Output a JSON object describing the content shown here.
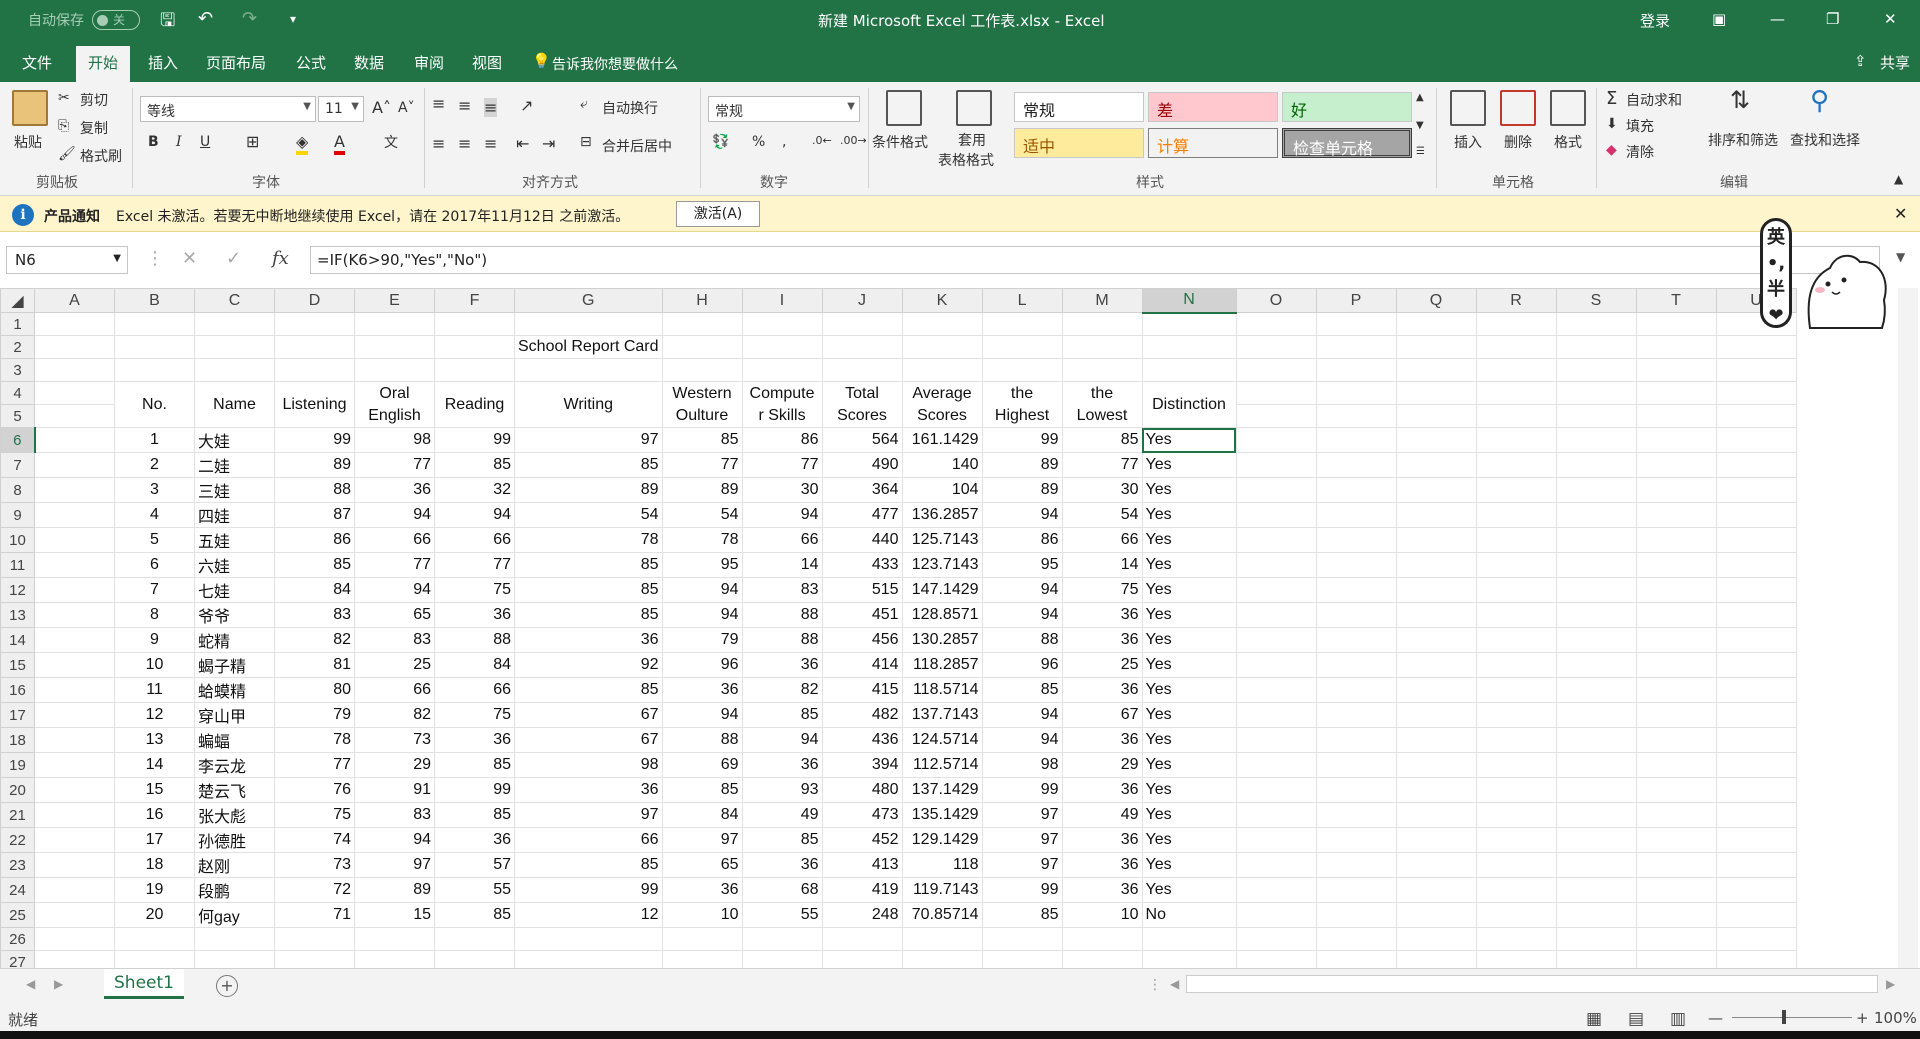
{
  "titlebar": {
    "autosave": "自动保存",
    "autosave_state": "关",
    "title": "新建 Microsoft Excel 工作表.xlsx  -  Excel",
    "login": "登录"
  },
  "menu": [
    "文件",
    "开始",
    "插入",
    "页面布局",
    "公式",
    "数据",
    "审阅",
    "视图"
  ],
  "tellme": "告诉我你想要做什么",
  "share": "共享",
  "ribbon": {
    "paste": "粘贴",
    "cut": "剪切",
    "copy": "复制",
    "format_painter": "格式刷",
    "font_name": "等线",
    "font_size": "11",
    "wrap": "自动换行",
    "merge": "合并后居中",
    "number_format": "常规",
    "cond_format": "条件格式",
    "table_format_1": "套用",
    "table_format_2": "表格格式",
    "styles": {
      "normal": "常规",
      "bad": "差",
      "good": "好",
      "neutral": "适中",
      "calc": "计算",
      "check": "检查单元格"
    },
    "insert": "插入",
    "delete": "删除",
    "format": "格式",
    "autosum": "自动求和",
    "fill": "填充",
    "clear": "清除",
    "sort_filter": "排序和筛选",
    "find_select": "查找和选择",
    "groups": {
      "clipboard": "剪贴板",
      "font": "字体",
      "alignment": "对齐方式",
      "number": "数字",
      "styles": "样式",
      "cells": "单元格",
      "editing": "编辑"
    }
  },
  "notification": {
    "label": "产品通知",
    "text": "Excel 未激活。若要无中断地继续使用 Excel，请在 2017年11月12日 之前激活。",
    "button": "激活(A)"
  },
  "formula_bar": {
    "name_box": "N6",
    "formula": "=IF(K6>90,\"Yes\",\"No\")"
  },
  "columns": [
    "A",
    "B",
    "C",
    "D",
    "E",
    "F",
    "G",
    "H",
    "I",
    "J",
    "K",
    "L",
    "M",
    "N",
    "O",
    "P",
    "Q",
    "R",
    "S",
    "T",
    "U"
  ],
  "sheet": {
    "title": "School Report Card",
    "headers": [
      "No.",
      "Name",
      "Listening",
      "Oral English",
      "Reading",
      "Writing",
      "Western Oulture",
      "Compute r Skills",
      "Total Scores",
      "Average Scores",
      "the Highest",
      "the Lowest",
      "Distinction"
    ],
    "rows": [
      [
        "1",
        "大娃",
        "99",
        "98",
        "99",
        "97",
        "85",
        "86",
        "564",
        "161.1429",
        "99",
        "85",
        "Yes"
      ],
      [
        "2",
        "二娃",
        "89",
        "77",
        "85",
        "85",
        "77",
        "77",
        "490",
        "140",
        "89",
        "77",
        "Yes"
      ],
      [
        "3",
        "三娃",
        "88",
        "36",
        "32",
        "89",
        "89",
        "30",
        "364",
        "104",
        "89",
        "30",
        "Yes"
      ],
      [
        "4",
        "四娃",
        "87",
        "94",
        "94",
        "54",
        "54",
        "94",
        "477",
        "136.2857",
        "94",
        "54",
        "Yes"
      ],
      [
        "5",
        "五娃",
        "86",
        "66",
        "66",
        "78",
        "78",
        "66",
        "440",
        "125.7143",
        "86",
        "66",
        "Yes"
      ],
      [
        "6",
        "六娃",
        "85",
        "77",
        "77",
        "85",
        "95",
        "14",
        "433",
        "123.7143",
        "95",
        "14",
        "Yes"
      ],
      [
        "7",
        "七娃",
        "84",
        "94",
        "75",
        "85",
        "94",
        "83",
        "515",
        "147.1429",
        "94",
        "75",
        "Yes"
      ],
      [
        "8",
        "爷爷",
        "83",
        "65",
        "36",
        "85",
        "94",
        "88",
        "451",
        "128.8571",
        "94",
        "36",
        "Yes"
      ],
      [
        "9",
        "蛇精",
        "82",
        "83",
        "88",
        "36",
        "79",
        "88",
        "456",
        "130.2857",
        "88",
        "36",
        "Yes"
      ],
      [
        "10",
        "蝎子精",
        "81",
        "25",
        "84",
        "92",
        "96",
        "36",
        "414",
        "118.2857",
        "96",
        "25",
        "Yes"
      ],
      [
        "11",
        "蛤蟆精",
        "80",
        "66",
        "66",
        "85",
        "36",
        "82",
        "415",
        "118.5714",
        "85",
        "36",
        "Yes"
      ],
      [
        "12",
        "穿山甲",
        "79",
        "82",
        "75",
        "67",
        "94",
        "85",
        "482",
        "137.7143",
        "94",
        "67",
        "Yes"
      ],
      [
        "13",
        "蝙蝠",
        "78",
        "73",
        "36",
        "67",
        "88",
        "94",
        "436",
        "124.5714",
        "94",
        "36",
        "Yes"
      ],
      [
        "14",
        "李云龙",
        "77",
        "29",
        "85",
        "98",
        "69",
        "36",
        "394",
        "112.5714",
        "98",
        "29",
        "Yes"
      ],
      [
        "15",
        "楚云飞",
        "76",
        "91",
        "99",
        "36",
        "85",
        "93",
        "480",
        "137.1429",
        "99",
        "36",
        "Yes"
      ],
      [
        "16",
        "张大彪",
        "75",
        "83",
        "85",
        "97",
        "84",
        "49",
        "473",
        "135.1429",
        "97",
        "49",
        "Yes"
      ],
      [
        "17",
        "孙德胜",
        "74",
        "94",
        "36",
        "66",
        "97",
        "85",
        "452",
        "129.1429",
        "97",
        "36",
        "Yes"
      ],
      [
        "18",
        "赵刚",
        "73",
        "97",
        "57",
        "85",
        "65",
        "36",
        "413",
        "118",
        "97",
        "36",
        "Yes"
      ],
      [
        "19",
        "段鹏",
        "72",
        "89",
        "55",
        "99",
        "36",
        "68",
        "419",
        "119.7143",
        "99",
        "36",
        "Yes"
      ],
      [
        "20",
        "何gay",
        "71",
        "15",
        "85",
        "12",
        "10",
        "55",
        "248",
        "70.85714",
        "85",
        "10",
        "No"
      ]
    ]
  },
  "sticker_text": [
    "英",
    "•,",
    "半",
    "❤"
  ],
  "sheet_tab": "Sheet1",
  "status": {
    "ready": "就绪",
    "zoom": "100%"
  }
}
